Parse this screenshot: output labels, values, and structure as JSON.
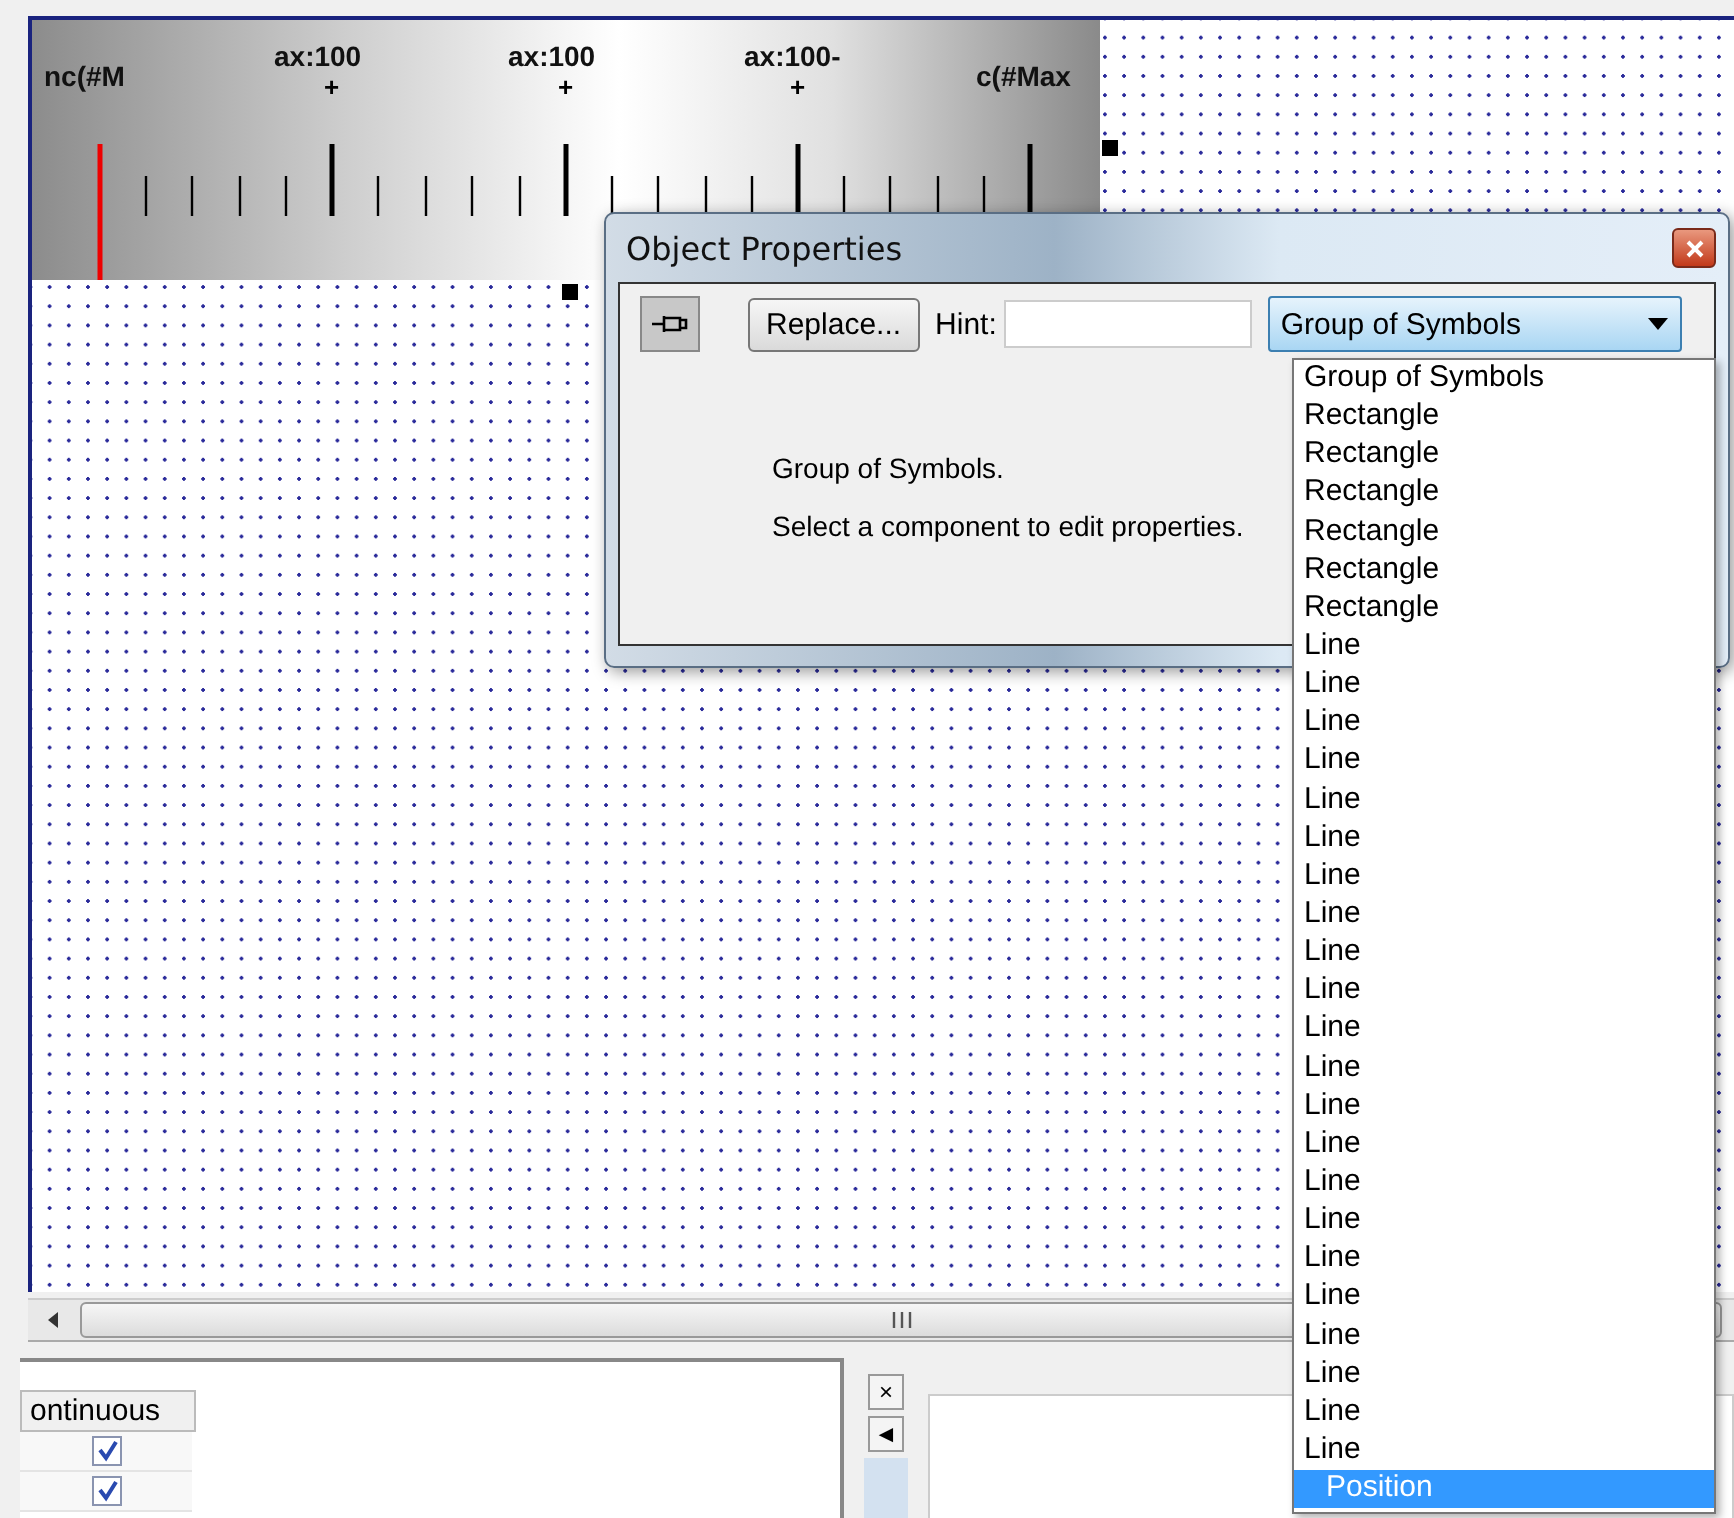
{
  "gauge": {
    "labels": [
      {
        "text": "nc(#M"
      },
      {
        "text": "ax:100",
        "marker": "+"
      },
      {
        "text": "ax:100",
        "marker": "+"
      },
      {
        "text": "ax:100-",
        "marker": "+"
      },
      {
        "text": "c(#Max"
      }
    ]
  },
  "dialog": {
    "title": "Object Properties",
    "replace_button": "Replace...",
    "hint_label": "Hint:",
    "combo_value": "Group of Symbols",
    "description": "Group of Symbols.",
    "instruction": "Select a component to edit properties."
  },
  "dropdown": {
    "items": [
      {
        "label": "Group of Symbols",
        "selected": false
      },
      {
        "label": "Rectangle",
        "selected": false
      },
      {
        "label": "Rectangle",
        "selected": false
      },
      {
        "label": "Rectangle",
        "selected": false
      },
      {
        "label": "Rectangle",
        "selected": false
      },
      {
        "label": "Rectangle",
        "selected": false
      },
      {
        "label": "Rectangle",
        "selected": false
      },
      {
        "label": "Line",
        "selected": false
      },
      {
        "label": "Line",
        "selected": false
      },
      {
        "label": "Line",
        "selected": false
      },
      {
        "label": "Line",
        "selected": false
      },
      {
        "label": "Line",
        "selected": false
      },
      {
        "label": "Line",
        "selected": false
      },
      {
        "label": "Line",
        "selected": false
      },
      {
        "label": "Line",
        "selected": false
      },
      {
        "label": "Line",
        "selected": false
      },
      {
        "label": "Line",
        "selected": false
      },
      {
        "label": "Line",
        "selected": false
      },
      {
        "label": "Line",
        "selected": false
      },
      {
        "label": "Line",
        "selected": false
      },
      {
        "label": "Line",
        "selected": false
      },
      {
        "label": "Line",
        "selected": false
      },
      {
        "label": "Line",
        "selected": false
      },
      {
        "label": "Line",
        "selected": false
      },
      {
        "label": "Line",
        "selected": false
      },
      {
        "label": "Line",
        "selected": false
      },
      {
        "label": "Line",
        "selected": false
      },
      {
        "label": "Line",
        "selected": false
      },
      {
        "label": "Line",
        "selected": false
      },
      {
        "label": "Position",
        "selected": true
      }
    ]
  },
  "grid": {
    "column_header": "ontinuous",
    "rows": [
      {
        "checked": true
      },
      {
        "checked": true
      }
    ]
  },
  "side_buttons": {
    "close": "×",
    "left": "◄"
  }
}
